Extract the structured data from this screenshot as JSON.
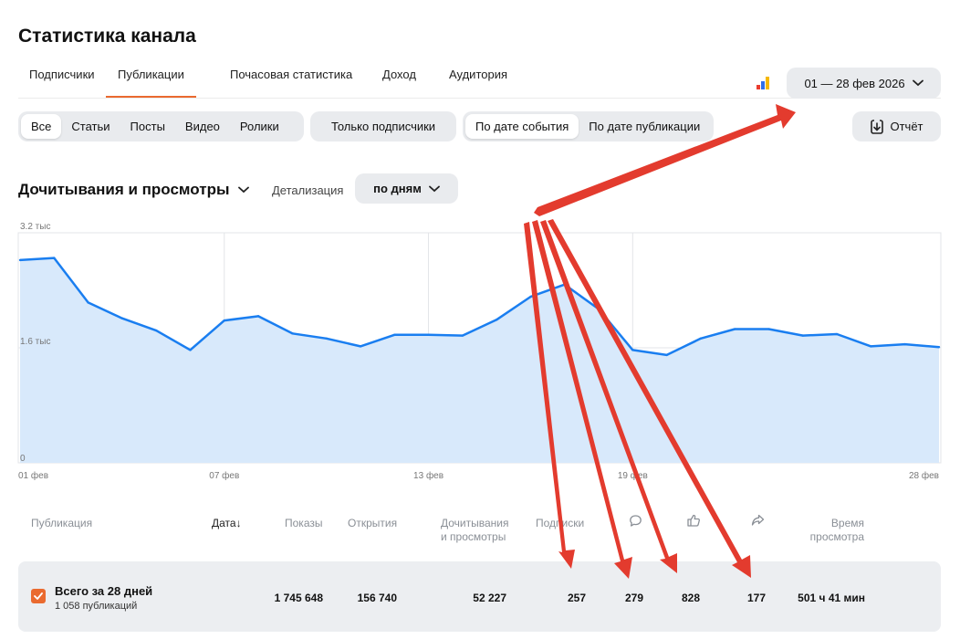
{
  "page_title": "Статистика канала",
  "tabs": [
    "Подписчики",
    "Публикации",
    "Почасовая статистика",
    "Доход",
    "Аудитория"
  ],
  "active_tab": "Публикации",
  "date_range": "01 — 28 фев 2026",
  "filters": {
    "types": [
      "Все",
      "Статьи",
      "Посты",
      "Видео",
      "Ролики"
    ],
    "selected_type": "Все",
    "subscribers_only": "Только подписчики",
    "date_modes": [
      "По дате события",
      "По дате публикации"
    ],
    "selected_date_mode": "По дате события"
  },
  "report_button": "Отчёт",
  "metric_selector": "Дочитывания и просмотры",
  "detail": {
    "label": "Детализация",
    "value": "по дням"
  },
  "colors": {
    "accent": "#ea6a2f",
    "line": "#1a7ef0",
    "area": "#d8e9fb",
    "arrow": "#e33b2e"
  },
  "chart_data": {
    "type": "area",
    "x": [
      "01 фев",
      "02 фев",
      "03 фев",
      "04 фев",
      "05 фев",
      "06 фев",
      "07 фев",
      "08 фев",
      "09 фев",
      "10 фев",
      "11 фев",
      "12 фев",
      "13 фев",
      "14 фев",
      "15 фев",
      "16 фев",
      "17 фев",
      "18 фев",
      "19 фев",
      "20 фев",
      "21 фев",
      "22 фев",
      "23 фев",
      "24 фев",
      "25 фев",
      "26 фев",
      "27 фев",
      "28 фев"
    ],
    "values": [
      2820,
      2850,
      2230,
      2010,
      1840,
      1570,
      1980,
      2040,
      1800,
      1730,
      1620,
      1780,
      1780,
      1770,
      1990,
      2310,
      2480,
      2140,
      1570,
      1500,
      1730,
      1860,
      1860,
      1770,
      1790,
      1620,
      1650,
      1610
    ],
    "y_ticks": [
      "3.2 тыс",
      "1.6 тыс",
      "0"
    ],
    "x_ticks": [
      "01 фев",
      "07 фев",
      "13 фев",
      "19 фев",
      "28 фев"
    ],
    "ylim": [
      0,
      3200
    ],
    "grid": true
  },
  "table": {
    "headers": {
      "publication": "Публикация",
      "date": "Дата",
      "sort_arrow": "↓",
      "impressions": "Показы",
      "opens": "Открытия",
      "reads_l1": "Дочитывания",
      "reads_l2": "и просмотры",
      "subscriptions": "Подписки",
      "time_l1": "Время",
      "time_l2": "просмотра"
    },
    "header_icons": [
      "comment-icon",
      "like-icon",
      "share-icon"
    ],
    "total": {
      "title": "Всего за 28 дней",
      "subtitle": "1 058 публикаций",
      "impressions": "1 745 648",
      "opens": "156 740",
      "reads": "52 227",
      "subscriptions": "257",
      "comments": "279",
      "likes": "828",
      "shares": "177",
      "watch_time": "501 ч 41 мин"
    }
  }
}
